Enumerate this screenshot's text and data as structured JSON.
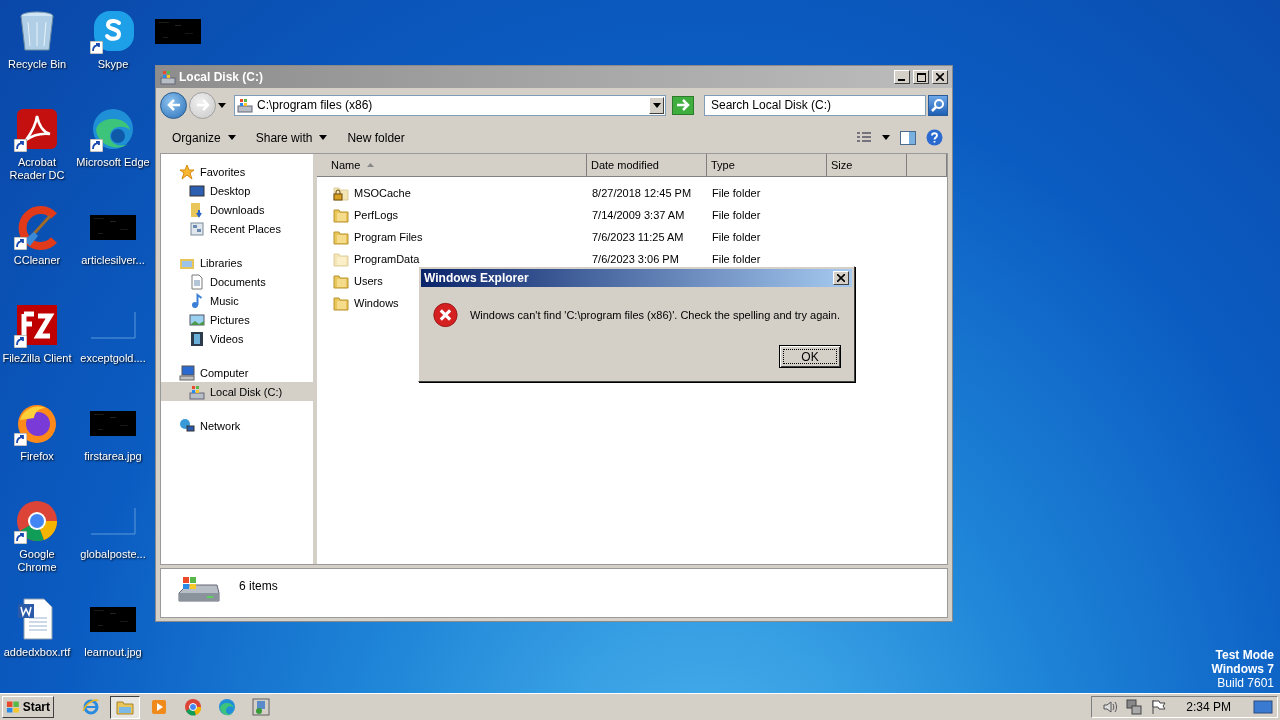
{
  "desktop": {
    "icon_columns": [
      [
        {
          "label": "Recycle Bin",
          "kind": "recycle",
          "shortcut": false
        },
        {
          "label": "Acrobat Reader DC",
          "kind": "acrobat",
          "shortcut": true
        },
        {
          "label": "CCleaner",
          "kind": "ccleaner",
          "shortcut": true
        },
        {
          "label": "FileZilla Client",
          "kind": "filezilla",
          "shortcut": true
        },
        {
          "label": "Firefox",
          "kind": "firefox",
          "shortcut": true
        },
        {
          "label": "Google Chrome",
          "kind": "chrome",
          "shortcut": true
        },
        {
          "label": "addedxbox.rtf",
          "kind": "word",
          "shortcut": false
        }
      ],
      [
        {
          "label": "Skype",
          "kind": "skype",
          "shortcut": true
        },
        {
          "label": "Microsoft Edge",
          "kind": "edge",
          "shortcut": true
        },
        {
          "label": "articlesilver...",
          "kind": "thumbnail",
          "shortcut": false
        },
        {
          "label": "exceptgold....",
          "kind": "blank",
          "shortcut": false
        },
        {
          "label": "firstarea.jpg",
          "kind": "thumbnail",
          "shortcut": false
        },
        {
          "label": "globalposte...",
          "kind": "blank",
          "shortcut": false
        },
        {
          "label": "learnout.jpg",
          "kind": "thumbnail",
          "shortcut": false
        }
      ],
      [
        {
          "kind": "thumbnail",
          "shortcut": false
        }
      ]
    ],
    "system_text": [
      {
        "text": "Test Mode",
        "bold": true
      },
      {
        "text": "Windows 7",
        "bold": true
      },
      {
        "text": "Build 7601",
        "bold": false
      }
    ]
  },
  "window": {
    "title": "Local Disk (C:)",
    "address": {
      "value": "C:\\program files (x86)"
    },
    "search": {
      "placeholder": "Search Local Disk (C:)"
    },
    "toolbar": [
      {
        "label": "Organize",
        "menu": true
      },
      {
        "label": "Share with",
        "menu": true
      },
      {
        "label": "New folder",
        "menu": false
      }
    ],
    "sidebar": [
      {
        "label": "Favorites",
        "kind": "star",
        "selected": false,
        "children": [
          {
            "label": "Desktop",
            "kind": "desktop",
            "selected": false
          },
          {
            "label": "Downloads",
            "kind": "downloads",
            "selected": false
          },
          {
            "label": "Recent Places",
            "kind": "recent",
            "selected": false
          }
        ]
      },
      {
        "label": "Libraries",
        "kind": "library",
        "selected": false,
        "children": [
          {
            "label": "Documents",
            "kind": "documents",
            "selected": false
          },
          {
            "label": "Music",
            "kind": "music",
            "selected": false
          },
          {
            "label": "Pictures",
            "kind": "pictures",
            "selected": false
          },
          {
            "label": "Videos",
            "kind": "videos",
            "selected": false
          }
        ]
      },
      {
        "label": "Computer",
        "kind": "computer",
        "selected": false,
        "children": [
          {
            "label": "Local Disk (C:)",
            "kind": "drive",
            "selected": true
          }
        ]
      },
      {
        "label": "Network",
        "kind": "network",
        "selected": false
      }
    ],
    "columns": [
      {
        "label": "Name",
        "sorted": true
      },
      {
        "label": "Date modified",
        "sorted": false
      },
      {
        "label": "Type",
        "sorted": false
      },
      {
        "label": "Size",
        "sorted": false
      }
    ],
    "rows": [
      {
        "name": "MSOCache",
        "date": "8/27/2018 12:45 PM",
        "type": "File folder",
        "locked": true,
        "hidden": true
      },
      {
        "name": "PerfLogs",
        "date": "7/14/2009 3:37 AM",
        "type": "File folder",
        "locked": false,
        "hidden": false
      },
      {
        "name": "Program Files",
        "date": "7/6/2023 11:25 AM",
        "type": "File folder",
        "locked": false,
        "hidden": false
      },
      {
        "name": "ProgramData",
        "date": "7/6/2023 3:06 PM",
        "type": "File folder",
        "locked": false,
        "hidden": true
      },
      {
        "name": "Users",
        "locked": false,
        "hidden": false
      },
      {
        "name": "Windows",
        "locked": false,
        "hidden": false
      }
    ],
    "details": {
      "count": "6 items"
    }
  },
  "dialog": {
    "title": "Windows Explorer",
    "message": "Windows can't find 'C:\\program files (x86)'.  Check the spelling and try again.",
    "button": "OK"
  },
  "taskbar": {
    "start": "Start",
    "apps": [
      {
        "kind": "ie",
        "active": false
      },
      {
        "kind": "explorer",
        "active": true
      },
      {
        "kind": "media",
        "active": false
      },
      {
        "kind": "chrome",
        "active": false
      },
      {
        "kind": "edge",
        "active": false
      },
      {
        "kind": "app",
        "active": false
      }
    ],
    "tray": [
      {
        "kind": "speaker"
      },
      {
        "kind": "network"
      },
      {
        "kind": "flag"
      }
    ],
    "clock": "2:34 PM"
  }
}
